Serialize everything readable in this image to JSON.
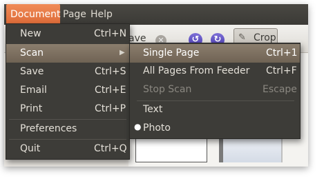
{
  "menubar": {
    "items": [
      {
        "label": "Document"
      },
      {
        "label": "Page"
      },
      {
        "label": "Help"
      }
    ]
  },
  "toolbar": {
    "save_partial_label": "ave",
    "crop_label": "Crop"
  },
  "document_menu": {
    "items": [
      {
        "label": "New",
        "accel": "Ctrl+N"
      },
      {
        "label": "Scan",
        "accel": ""
      },
      {
        "label": "Save",
        "accel": "Ctrl+S"
      },
      {
        "label": "Email",
        "accel": "Ctrl+E"
      },
      {
        "label": "Print",
        "accel": "Ctrl+P"
      },
      {
        "label": "Preferences",
        "accel": ""
      },
      {
        "label": "Quit",
        "accel": "Ctrl+Q"
      }
    ]
  },
  "scan_submenu": {
    "items": [
      {
        "label": "Single Page",
        "accel": "Ctrl+1"
      },
      {
        "label": "All Pages From Feeder",
        "accel": "Ctrl+F"
      },
      {
        "label": "Stop Scan",
        "accel": "Escape"
      },
      {
        "label": "Text",
        "accel": ""
      },
      {
        "label": "Photo",
        "accel": ""
      }
    ]
  },
  "colors": {
    "menu_bg": "#3d3c38",
    "menu_highlight": "#7d7161",
    "menubar_active": "#e8784a",
    "menu_text": "#e4e0d8",
    "disabled_text": "#8a8780"
  }
}
